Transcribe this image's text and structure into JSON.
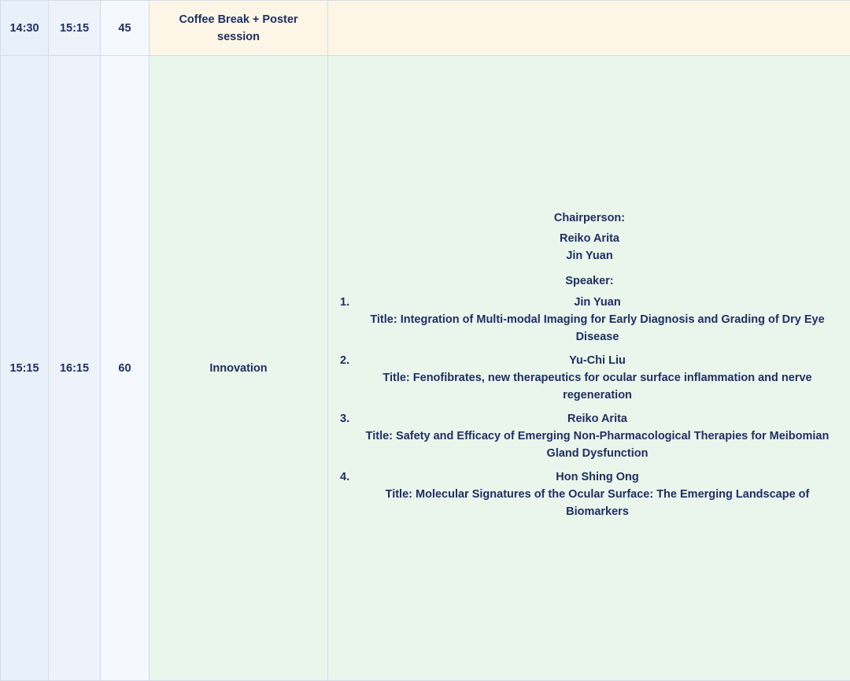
{
  "rows": [
    {
      "start": "14:30",
      "end": "15:15",
      "duration": "45",
      "session": "Coffee Break + Poster session",
      "detail": ""
    },
    {
      "start": "15:15",
      "end": "16:15",
      "duration": "60",
      "session": "Innovation",
      "chair_label": "Chairperson:",
      "chairpersons": [
        "Reiko Arita",
        "Jin Yuan"
      ],
      "speaker_label": "Speaker:",
      "speakers": [
        {
          "number": "1.",
          "name": "Jin Yuan",
          "title": "Title: Integration of Multi-modal Imaging for Early Diagnosis and Grading of Dry Eye Disease"
        },
        {
          "number": "2.",
          "name": "Yu-Chi Liu",
          "title": "Title: Fenofibrates, new therapeutics for ocular surface inflammation and nerve regeneration"
        },
        {
          "number": "3.",
          "name": "Reiko Arita",
          "title": "Title: Safety and Efficacy of Emerging Non-Pharmacological Therapies for Meibomian Gland Dysfunction"
        },
        {
          "number": "4.",
          "name": "Hon Shing Ong",
          "title": "Title: Molecular Signatures of the Ocular Surface: The Emerging Landscape of Biomarkers"
        }
      ]
    }
  ]
}
